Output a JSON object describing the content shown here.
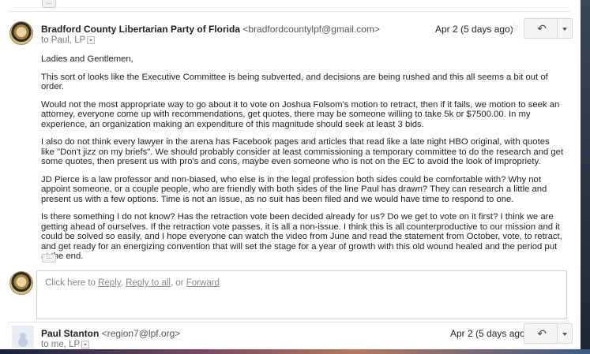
{
  "message1": {
    "sender_name": "Bradford County Libertarian Party of Florida",
    "sender_email": "<bradfordcountylpf@gmail.com>",
    "to_line": "to Paul, LP",
    "date": "Apr 2 (5 days ago)",
    "reply_icon": "reply-arrow-icon",
    "paragraphs": [
      "Ladies and Gentlemen,",
      "This sort of looks like the Executive Committee is being subverted, and decisions are being rushed and this all seems a bit out of order.",
      "Would not the most appropriate way to go about it to vote on Joshua Folsom's motion to retract, then if it fails, we motion to seek an attorney, everyone come up with recommendations, get quotes, there may be someone willing to take 5k or $7500.00. In my experience, an organization making an expenditure of this magnitude should seek at least 3 bids.",
      "I also do not think every lawyer in the arena has Facebook pages and articles that read like a late night HBO original,  with quotes like \"Don't jizz on my briefs\". We should probably consider at least commissioning a temporary committee to do the research and get some quotes, then present us with pro's and cons, maybe even someone who is not on the EC to avoid the look of impropriety.",
      "JD Pierce is a law professor and non-biased, who else is in the legal profession both sides could be comfortable with?  Why not appoint someone, or a couple people, who are friendly with both sides of the line Paul has drawn? They can research a little and present us with a few options. Time is not an issue, as no suit has been filed and we would have time to respond to one.",
      "Is there something I do not know? Has the retraction vote been decided already for us? Do we get to vote on it first? I think we are getting ahead of ourselves. If the retraction vote passes, it is all a non-issue. I think this is all counterproductive to our mission and it could be solved so easily, and I hope everyone can watch the video from June and read the statement from October, vote, to retract, and get ready for an energizing convention that will set the stage for a year of growth with this old wound healed and the period put at the end."
    ]
  },
  "reply_box": {
    "prefix": "Click here to ",
    "reply": "Reply",
    "sep1": ", ",
    "reply_all": "Reply to all",
    "sep2": ", or ",
    "forward": "Forward"
  },
  "message2": {
    "sender_name": "Paul Stanton",
    "sender_email": "<region7@lpf.org>",
    "to_line": "to me, LP",
    "date": "Apr 2 (5 days ago)"
  }
}
